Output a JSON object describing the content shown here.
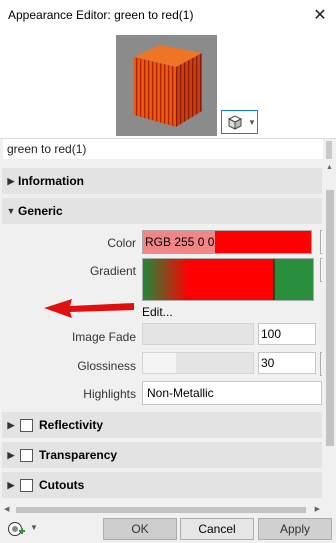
{
  "window": {
    "title": "Appearance Editor: green to red(1)"
  },
  "preview": {
    "scene_icon": "cube-icon",
    "colors": {
      "top": "#e8600d",
      "left": "#d6401a",
      "right": "#b82a10",
      "background": "#8b8b8b"
    }
  },
  "name_field": {
    "value": "green to red(1)"
  },
  "sections": {
    "information": "Information",
    "generic": "Generic",
    "reflectivity": "Reflectivity",
    "transparency": "Transparency",
    "cutouts": "Cutouts"
  },
  "generic": {
    "color_label": "Color",
    "color_value": "RGB 255 0 0",
    "color_hex": "#ff0000",
    "gradient_label": "Gradient",
    "gradient_stops": [
      "#1f8a3a",
      "#ff0000",
      "#ff0000",
      "#1f8a3a"
    ],
    "edit_link": "Edit...",
    "image_fade_label": "Image Fade",
    "image_fade_value": "100",
    "glossiness_label": "Glossiness",
    "glossiness_value": "30",
    "highlights_label": "Highlights",
    "highlights_value": "Non-Metallic"
  },
  "footer": {
    "ok": "OK",
    "cancel": "Cancel",
    "apply": "Apply"
  }
}
